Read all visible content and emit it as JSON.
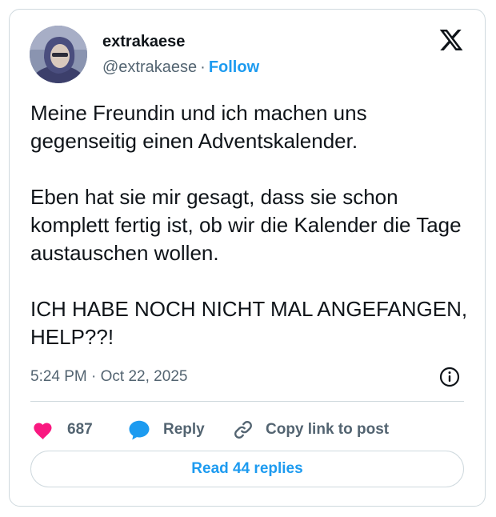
{
  "author": {
    "display_name": "extrakaese",
    "handle": "@extrakaese",
    "separator": "·",
    "follow_label": "Follow"
  },
  "brand": {
    "logo_icon": "x-logo-icon"
  },
  "tweet": {
    "paragraphs": [
      "Meine Freundin und ich machen uns gegenseitig einen Adventskalender.",
      "Eben hat sie mir gesagt, dass sie schon komplett fertig ist, ob wir die Kalender die Tage austauschen wollen.",
      "ICH HABE NOCH NICHT MAL ANGEFANGEN, HELP??!"
    ],
    "time": "5:24 PM",
    "date_separator": "·",
    "date": "Oct 22, 2025"
  },
  "actions": {
    "likes_count": "687",
    "reply_label": "Reply",
    "copy_link_label": "Copy link to post",
    "read_replies_label": "Read 44 replies"
  },
  "colors": {
    "accent": "#1d9bf0",
    "like": "#f91880",
    "text": "#0f1419",
    "secondary": "#536471",
    "border": "#cfd9de"
  }
}
